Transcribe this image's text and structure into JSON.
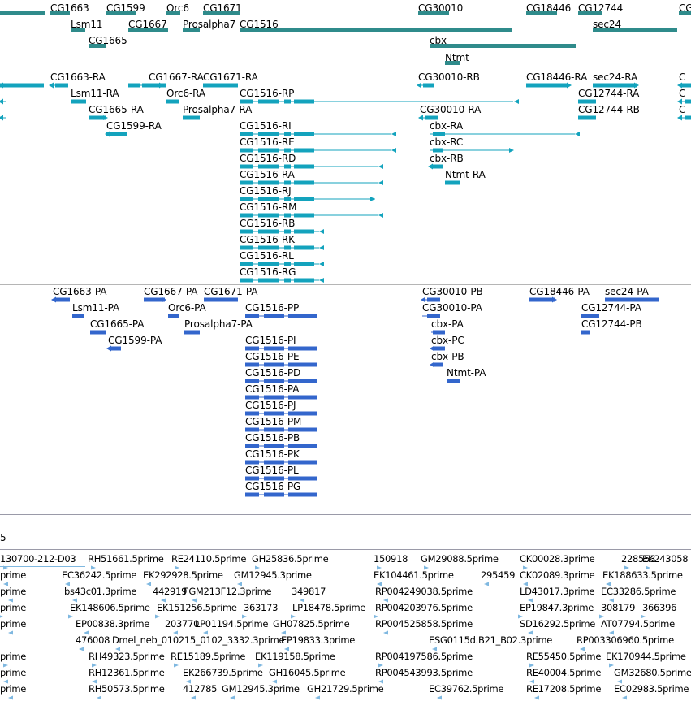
{
  "colors": {
    "gene_track": "#2f8b8b",
    "transcript_track": "#13a3bd",
    "protein_track": "#3366cc",
    "est_track": "#7fb8e0"
  },
  "tracks": {
    "genes": {
      "features": [
        {
          "label": "CG1663"
        },
        {
          "label": "CG1599"
        },
        {
          "label": "Orc6"
        },
        {
          "label": "CG1671"
        },
        {
          "label": "CG30010"
        },
        {
          "label": "CG18446"
        },
        {
          "label": "CG12744"
        },
        {
          "label": "CG"
        },
        {
          "label": "Lsm11"
        },
        {
          "label": "CG1667"
        },
        {
          "label": "Prosalpha7"
        },
        {
          "label": "CG1516"
        },
        {
          "label": "sec24"
        },
        {
          "label": "CG1665"
        },
        {
          "label": "cbx"
        },
        {
          "label": "Ntmt"
        }
      ]
    },
    "transcripts": {
      "features": [
        {
          "label": "CG1663-RA"
        },
        {
          "label": "CG1667-RA"
        },
        {
          "label": "CG1671-RA"
        },
        {
          "label": "CG30010-RB"
        },
        {
          "label": "CG18446-RA"
        },
        {
          "label": "sec24-RA"
        },
        {
          "label": "C"
        },
        {
          "label": "Lsm11-RA"
        },
        {
          "label": "Orc6-RA"
        },
        {
          "label": "CG1516-RP"
        },
        {
          "label": "CG12744-RA"
        },
        {
          "label": "C"
        },
        {
          "label": "CG1665-RA"
        },
        {
          "label": "Prosalpha7-RA"
        },
        {
          "label": "CG30010-RA"
        },
        {
          "label": "CG12744-RB"
        },
        {
          "label": "C"
        },
        {
          "label": "CG1599-RA"
        },
        {
          "label": "CG1516-RI"
        },
        {
          "label": "cbx-RA"
        },
        {
          "label": "CG1516-RE"
        },
        {
          "label": "cbx-RC"
        },
        {
          "label": "CG1516-RD"
        },
        {
          "label": "cbx-RB"
        },
        {
          "label": "CG1516-RA"
        },
        {
          "label": "Ntmt-RA"
        },
        {
          "label": "CG1516-RJ"
        },
        {
          "label": "CG1516-RM"
        },
        {
          "label": "CG1516-RB"
        },
        {
          "label": "CG1516-RK"
        },
        {
          "label": "CG1516-RL"
        },
        {
          "label": "CG1516-RG"
        }
      ]
    },
    "proteins": {
      "features": [
        {
          "label": "CG1663-PA"
        },
        {
          "label": "CG1667-PA"
        },
        {
          "label": "CG1671-PA"
        },
        {
          "label": "CG30010-PB"
        },
        {
          "label": "CG18446-PA"
        },
        {
          "label": "sec24-PA"
        },
        {
          "label": "Lsm11-PA"
        },
        {
          "label": "Orc6-PA"
        },
        {
          "label": "CG1516-PP"
        },
        {
          "label": "CG30010-PA"
        },
        {
          "label": "CG12744-PA"
        },
        {
          "label": "CG1665-PA"
        },
        {
          "label": "Prosalpha7-PA"
        },
        {
          "label": "cbx-PA"
        },
        {
          "label": "CG12744-PB"
        },
        {
          "label": "CG1599-PA"
        },
        {
          "label": "CG1516-PI"
        },
        {
          "label": "cbx-PC"
        },
        {
          "label": "CG1516-PE"
        },
        {
          "label": "cbx-PB"
        },
        {
          "label": "CG1516-PD"
        },
        {
          "label": "Ntmt-PA"
        },
        {
          "label": "CG1516-PA"
        },
        {
          "label": "CG1516-PJ"
        },
        {
          "label": "CG1516-PM"
        },
        {
          "label": "CG1516-PB"
        },
        {
          "label": "CG1516-PK"
        },
        {
          "label": "CG1516-PL"
        },
        {
          "label": "CG1516-PG"
        }
      ]
    },
    "partial_label": "5",
    "ests": {
      "features": [
        {
          "label": "130700-212-D03"
        },
        {
          "label": "RH51661.5prime"
        },
        {
          "label": "RE24110.5prime"
        },
        {
          "label": "GH25836.5prime"
        },
        {
          "label": "150918"
        },
        {
          "label": "GM29088.5prime"
        },
        {
          "label": "CK00028.3prime"
        },
        {
          "label": "228553"
        },
        {
          "label": "EK243058"
        },
        {
          "label": "prime"
        },
        {
          "label": "EC36242.5prime"
        },
        {
          "label": "EK292928.5prime"
        },
        {
          "label": "GM12945.3prime"
        },
        {
          "label": "EK104461.5prime"
        },
        {
          "label": "295459"
        },
        {
          "label": "CK02089.3prime"
        },
        {
          "label": "EK188633.5prime"
        },
        {
          "label": "prime"
        },
        {
          "label": "bs43c01.3prime"
        },
        {
          "label": "442919"
        },
        {
          "label": "FGM213F12.3prime"
        },
        {
          "label": "349817"
        },
        {
          "label": "RP004249038.5prime"
        },
        {
          "label": "LD43017.3prime"
        },
        {
          "label": "EC33286.5prime"
        },
        {
          "label": "prime"
        },
        {
          "label": "EK148606.5prime"
        },
        {
          "label": "EK151256.5prime"
        },
        {
          "label": "363173"
        },
        {
          "label": "LP18478.5prime"
        },
        {
          "label": "RP004203976.5prime"
        },
        {
          "label": "EP19847.3prime"
        },
        {
          "label": "308179"
        },
        {
          "label": "366396"
        },
        {
          "label": "prime"
        },
        {
          "label": "EP00838.3prime"
        },
        {
          "label": "203770"
        },
        {
          "label": "LP01194.5prime"
        },
        {
          "label": "GH07825.5prime"
        },
        {
          "label": "RP004525858.5prime"
        },
        {
          "label": "SD16292.5prime"
        },
        {
          "label": "AT07794.5prime"
        },
        {
          "label": "476008"
        },
        {
          "label": "Dmel_neb_010215_0102_3332.3prime"
        },
        {
          "label": "EP19833.3prime"
        },
        {
          "label": "ESG0115d.B21_B02.3prime"
        },
        {
          "label": "RP003306960.5prime"
        },
        {
          "label": "prime"
        },
        {
          "label": "RH49323.5prime"
        },
        {
          "label": "RE15189.5prime"
        },
        {
          "label": "EK119158.5prime"
        },
        {
          "label": "RP004197586.5prime"
        },
        {
          "label": "RE55450.5prime"
        },
        {
          "label": "EK170944.5prime"
        },
        {
          "label": "prime"
        },
        {
          "label": "RH12361.5prime"
        },
        {
          "label": "EK266739.5prime"
        },
        {
          "label": "GH16045.5prime"
        },
        {
          "label": "RP004543993.5prime"
        },
        {
          "label": "RE40004.5prime"
        },
        {
          "label": "GM32680.5prime"
        },
        {
          "label": "prime"
        },
        {
          "label": "RH50573.5prime"
        },
        {
          "label": "412785"
        },
        {
          "label": "GM12945.3prime"
        },
        {
          "label": "GH21729.5prime"
        },
        {
          "label": "EC39762.5prime"
        },
        {
          "label": "RE17208.5prime"
        },
        {
          "label": "EC02983.5prime"
        }
      ]
    }
  }
}
